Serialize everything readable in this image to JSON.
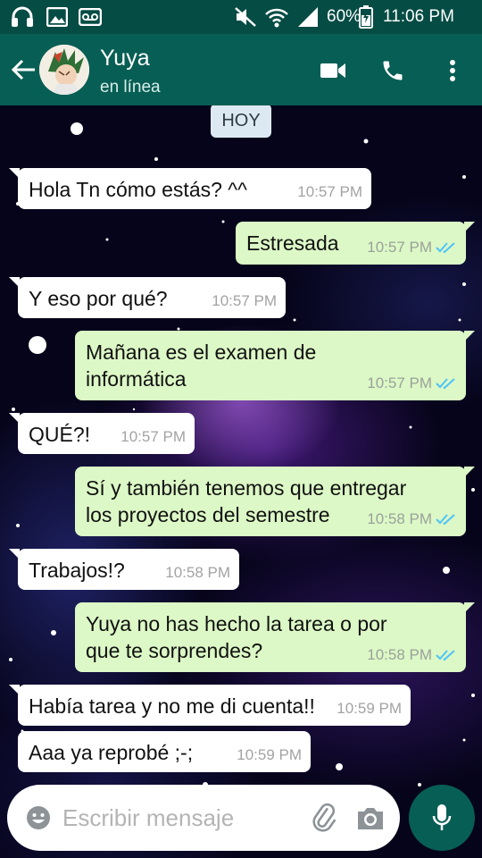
{
  "status_bar": {
    "battery_percent": "60%",
    "time": "11:06 PM"
  },
  "header": {
    "contact_name": "Yuya",
    "contact_status": "en línea"
  },
  "chat": {
    "date_label": "HOY",
    "messages": [
      {
        "direction": "in",
        "text": "Hola Tn cómo estás? ^^",
        "time": "10:57 PM"
      },
      {
        "direction": "out",
        "text": "Estresada",
        "time": "10:57 PM",
        "ticks": "read"
      },
      {
        "direction": "in",
        "text": "Y eso por qué?",
        "time": "10:57 PM"
      },
      {
        "direction": "out",
        "text": "Mañana es el examen de\ninformática",
        "time": "10:57 PM",
        "ticks": "read"
      },
      {
        "direction": "in",
        "text": "QUÉ?!",
        "time": "10:57 PM"
      },
      {
        "direction": "out",
        "text": "Sí y también tenemos que entregar\nlos proyectos del semestre",
        "time": "10:58 PM",
        "ticks": "read"
      },
      {
        "direction": "in",
        "text": "Trabajos!?",
        "time": "10:58 PM"
      },
      {
        "direction": "out",
        "text": "Yuya no has hecho la tarea o por\nque te sorprendes?",
        "time": "10:58 PM",
        "ticks": "read"
      },
      {
        "direction": "in",
        "text": "Había tarea y no me di cuenta!!",
        "time": "10:59 PM"
      },
      {
        "direction": "in",
        "text": "Aaa ya reprobé ;-;",
        "time": "10:59 PM"
      }
    ]
  },
  "input": {
    "placeholder": "Escribir mensaje"
  },
  "colors": {
    "header": "#075e54",
    "status_bar": "#054c44",
    "outgoing_bubble": "#dcf8c6",
    "incoming_bubble": "#ffffff",
    "read_ticks": "#4fc3f7"
  },
  "icons": [
    "headphones-icon",
    "image-icon",
    "voicemail-icon",
    "mute-icon",
    "wifi-icon",
    "signal-icon",
    "battery-icon",
    "back-arrow-icon",
    "video-call-icon",
    "phone-icon",
    "more-vert-icon",
    "emoji-icon",
    "attach-icon",
    "camera-icon",
    "mic-icon",
    "double-check-icon"
  ]
}
